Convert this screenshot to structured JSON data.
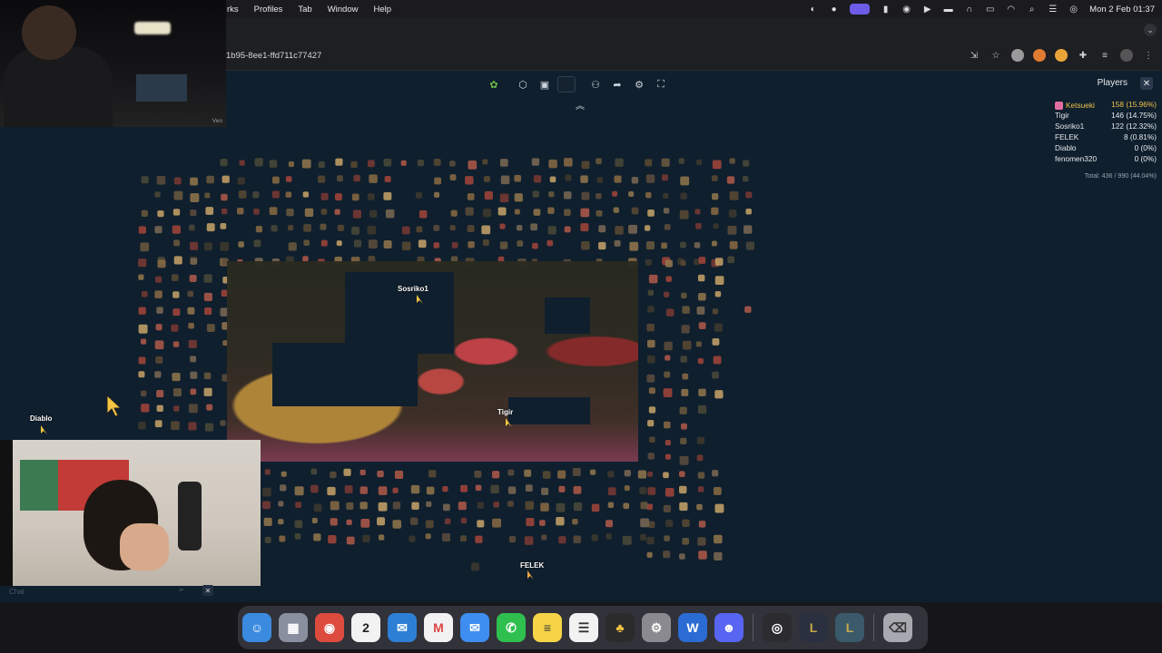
{
  "menubar": {
    "items": [
      "rks",
      "Profiles",
      "Tab",
      "Window",
      "Help"
    ],
    "clock": "Mon 2 Feb  01:37"
  },
  "browser": {
    "url": "1b95-8ee1-ffd711c77427"
  },
  "game_toolbar": {
    "buttons": [
      "puzzle-icon",
      "piece-shape-icon",
      "image-preview-icon",
      "box-icon",
      "players-icon",
      "share-icon",
      "settings-icon",
      "fullscreen-icon"
    ]
  },
  "players_panel": {
    "title": "Players",
    "players": [
      {
        "name": "Ketsueki",
        "score": "158 (15.96%)"
      },
      {
        "name": "Tigir",
        "score": "146 (14.75%)"
      },
      {
        "name": "Sosriko1",
        "score": "122 (12.32%)"
      },
      {
        "name": "FELEK",
        "score": "8 (0.81%)"
      },
      {
        "name": "Diablo",
        "score": "0 (0%)"
      },
      {
        "name": "fenomen320",
        "score": "0 (0%)"
      }
    ],
    "total": "Total: 436 / 990 (44.04%)"
  },
  "cursor_labels": {
    "sosriko": "Sosriko1",
    "tigir": "Tigir",
    "diablo": "Diablo",
    "felek": "FELEK"
  },
  "chat": {
    "placeholder": "Chat"
  },
  "webcam": {
    "watermark": "Veo"
  },
  "dock": {
    "apps": [
      "finder-icon",
      "launchpad-icon",
      "chrome-icon",
      "calendar-icon",
      "mail-icon",
      "gmail-icon",
      "mail-app-icon",
      "whatsapp-icon",
      "notes-icon",
      "reminders-icon",
      "game-icon",
      "settings-icon",
      "word-icon",
      "discord-icon",
      "obs-icon",
      "league-icon",
      "league-alt-icon",
      "trash-icon"
    ],
    "calendar_day": "2"
  }
}
